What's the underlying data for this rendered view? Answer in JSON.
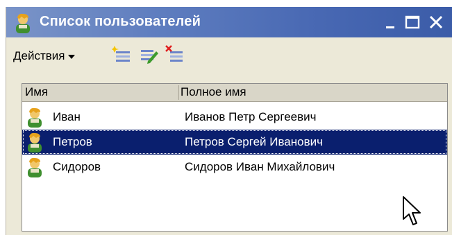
{
  "window": {
    "title": "Список пользователей",
    "icon": "user-icon",
    "controls": [
      "minimize-icon",
      "maximize-icon",
      "close-icon"
    ]
  },
  "toolbar": {
    "actions_label": "Действия",
    "buttons": [
      {
        "name": "add-user-icon"
      },
      {
        "name": "edit-user-icon"
      },
      {
        "name": "delete-user-icon"
      }
    ]
  },
  "list": {
    "columns": [
      "Имя",
      "Полное имя"
    ],
    "rows": [
      {
        "name": "Иван",
        "full_name": "Иванов Петр Сергеевич",
        "icon": "user-icon",
        "selected": false
      },
      {
        "name": "Петров",
        "full_name": "Петров Сергей Иванович",
        "icon": "user-icon",
        "selected": true
      },
      {
        "name": "Сидоров",
        "full_name": "Сидоров Иван Михайлович",
        "icon": "user-icon",
        "selected": false
      }
    ]
  },
  "colors": {
    "titlebar": "#4868b3",
    "selection": "#0a1f6e",
    "window_bg": "#ece9d8"
  }
}
